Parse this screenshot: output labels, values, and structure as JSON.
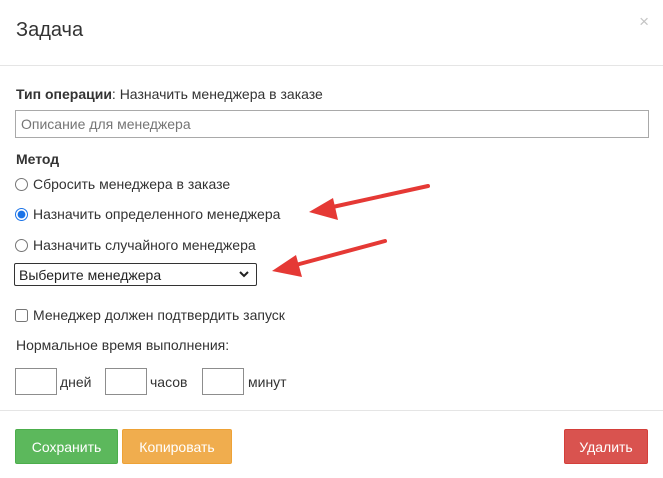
{
  "modal": {
    "title": "Задача",
    "close_glyph": "×"
  },
  "operation": {
    "label": "Тип операции",
    "value": ": Назначить менеджера в заказе"
  },
  "description": {
    "placeholder": "Описание для менеджера",
    "value": ""
  },
  "method": {
    "label": "Метод",
    "options": [
      {
        "label": "Сбросить менеджера в заказе",
        "checked": false
      },
      {
        "label": "Назначить определенного менеджера",
        "checked": true
      },
      {
        "label": "Назначить случайного менеджера",
        "checked": false
      }
    ]
  },
  "manager_select": {
    "selected": "Выберите менеджера"
  },
  "confirm_checkbox": {
    "label": "Менеджер должен подтвердить запуск",
    "checked": false
  },
  "time": {
    "label": "Нормальное время выполнения:",
    "days_unit": "дней",
    "hours_unit": "часов",
    "minutes_unit": "минут"
  },
  "footer": {
    "save_label": "Сохранить",
    "copy_label": "Копировать",
    "delete_label": "Удалить"
  },
  "colors": {
    "save": "#5cb85c",
    "copy": "#f0ad4e",
    "delete": "#d9534f",
    "annotation_arrow": "#e53935"
  },
  "icons": {
    "close": "close-icon",
    "select_chevron": "chevron-down-icon",
    "annotation": "arrow-annotation"
  }
}
